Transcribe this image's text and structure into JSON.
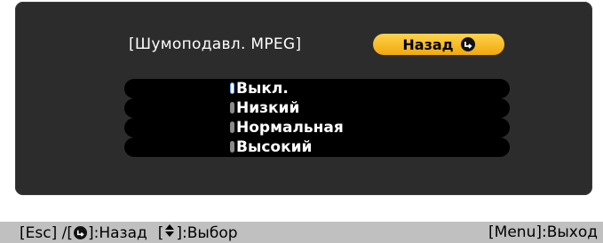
{
  "menu": {
    "title": "[Шумоподавл. MPEG]",
    "back_label": "Назад",
    "options": [
      {
        "label": "Выкл.",
        "selected": true
      },
      {
        "label": "Низкий",
        "selected": false
      },
      {
        "label": "Нормальная",
        "selected": false
      },
      {
        "label": "Высокий",
        "selected": false
      }
    ]
  },
  "help": {
    "esc_prefix": "[Esc] /[",
    "esc_suffix": "]:Назад",
    "select_prefix": "[",
    "select_suffix": "]:Выбор",
    "menu_exit": "[Menu]:Выход"
  },
  "icons": {
    "enter": "enter-icon",
    "updown": "up-down-arrow-icon"
  },
  "colors": {
    "panel": "#2c2c2c",
    "back_button": "#f5b81f",
    "option_bg": "#000000",
    "help_bar": "#c0c0c0"
  }
}
